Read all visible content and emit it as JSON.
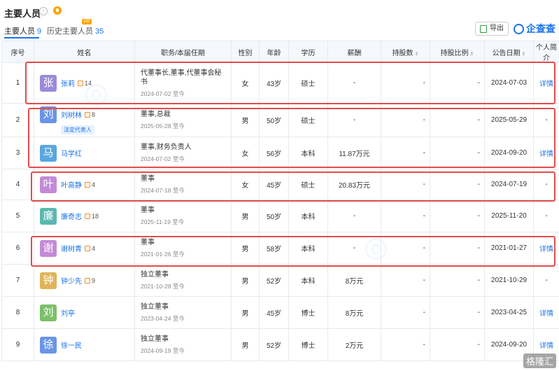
{
  "header": {
    "title": "主要人员",
    "tab_main_label": "主要人员",
    "tab_main_count": "9",
    "tab_history_label": "历史主要人员",
    "tab_history_count": "35",
    "vip": "VIP",
    "export_label": "导出",
    "brand": "企查查"
  },
  "columns": [
    "序号",
    "姓名",
    "职务/本届任期",
    "性别",
    "年龄",
    "学历",
    "薪酬",
    "持股数",
    "持股比例",
    "公告日期",
    "个人简介"
  ],
  "rows": [
    {
      "no": "1",
      "avatar": "张",
      "color": "#9c8ad9",
      "name": "张莉",
      "count": "14",
      "role": "代董事长,董事,代董事会秘书",
      "term": "2024-07-02 至今",
      "sex": "女",
      "age": "43岁",
      "edu": "硕士",
      "pay": "-",
      "shares": "-",
      "ratio": "-",
      "date": "2024-07-03",
      "bio": "详情"
    },
    {
      "no": "2",
      "avatar": "刘",
      "color": "#6a95e6",
      "name": "刘树林",
      "count": "8",
      "tag": "法定代表人",
      "role": "董事,总裁",
      "term": "2025-05-28 至今",
      "sex": "男",
      "age": "50岁",
      "edu": "硕士",
      "pay": "-",
      "shares": "-",
      "ratio": "-",
      "date": "2025-05-29",
      "bio": "-"
    },
    {
      "no": "3",
      "avatar": "马",
      "color": "#5aa6e0",
      "name": "马学红",
      "count": "",
      "role": "董事,财务负责人",
      "term": "2024-07-02 至今",
      "sex": "女",
      "age": "56岁",
      "edu": "本科",
      "pay": "11.87万元",
      "shares": "-",
      "ratio": "-",
      "date": "2024-09-20",
      "bio": "详情"
    },
    {
      "no": "4",
      "avatar": "叶",
      "color": "#c48ad6",
      "name": "叶高静",
      "count": "4",
      "role": "董事",
      "term": "2024-07-18 至今",
      "sex": "女",
      "age": "45岁",
      "edu": "硕士",
      "pay": "20.83万元",
      "shares": "-",
      "ratio": "-",
      "date": "2024-07-19",
      "bio": "-"
    },
    {
      "no": "5",
      "avatar": "廉",
      "color": "#5bb8b0",
      "name": "廉奇志",
      "count": "18",
      "role": "董事",
      "term": "2025-11-19 至今",
      "sex": "男",
      "age": "50岁",
      "edu": "本科",
      "pay": "-",
      "shares": "-",
      "ratio": "-",
      "date": "2025-11-20",
      "bio": "-"
    },
    {
      "no": "6",
      "avatar": "谢",
      "color": "#c48ad6",
      "name": "谢树青",
      "count": "4",
      "role": "董事",
      "term": "2021-01-26 至今",
      "sex": "男",
      "age": "58岁",
      "edu": "本科",
      "pay": "-",
      "shares": "-",
      "ratio": "-",
      "date": "2021-01-27",
      "bio": "详情"
    },
    {
      "no": "7",
      "avatar": "钟",
      "color": "#e0b45a",
      "name": "钟少先",
      "count": "9",
      "role": "独立董事",
      "term": "2021-10-28 至今",
      "sex": "男",
      "age": "52岁",
      "edu": "本科",
      "pay": "8万元",
      "shares": "-",
      "ratio": "-",
      "date": "2021-10-29",
      "bio": "-"
    },
    {
      "no": "8",
      "avatar": "刘",
      "color": "#7cbf6a",
      "name": "刘亭",
      "count": "",
      "role": "独立董事",
      "term": "2023-04-24 至今",
      "sex": "男",
      "age": "45岁",
      "edu": "博士",
      "pay": "8万元",
      "shares": "-",
      "ratio": "-",
      "date": "2023-04-25",
      "bio": "详情"
    },
    {
      "no": "9",
      "avatar": "徐",
      "color": "#6a95e6",
      "name": "徐一民",
      "count": "",
      "role": "独立董事",
      "term": "2024-09-19 至今",
      "sex": "男",
      "age": "52岁",
      "edu": "博士",
      "pay": "2万元",
      "shares": "-",
      "ratio": "-",
      "date": "2024-09-20",
      "bio": "详情"
    }
  ],
  "corner_mark": "格隆汇"
}
